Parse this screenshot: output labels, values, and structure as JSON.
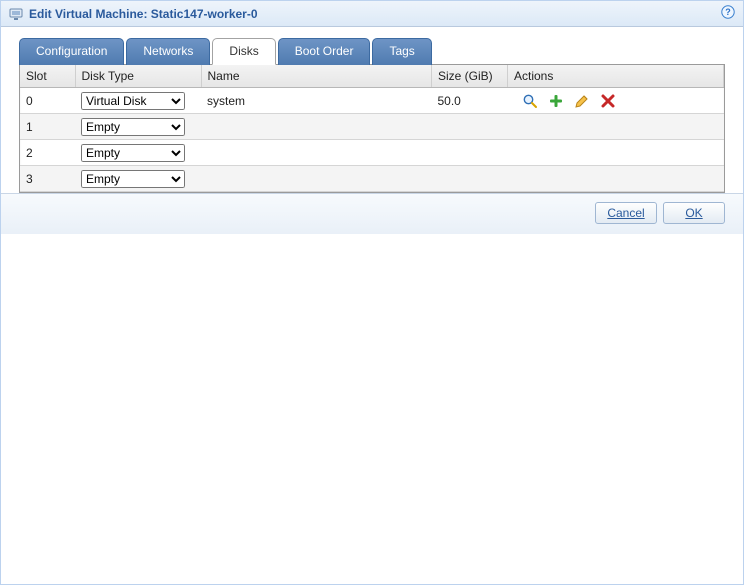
{
  "window": {
    "title": "Edit Virtual Machine: Static147-worker-0",
    "help_tooltip": "Help"
  },
  "tabs": [
    {
      "id": "configuration",
      "label": "Configuration",
      "active": false
    },
    {
      "id": "networks",
      "label": "Networks",
      "active": false
    },
    {
      "id": "disks",
      "label": "Disks",
      "active": true
    },
    {
      "id": "boot-order",
      "label": "Boot Order",
      "active": false
    },
    {
      "id": "tags",
      "label": "Tags",
      "active": false
    }
  ],
  "columns": {
    "slot": "Slot",
    "type": "Disk Type",
    "name": "Name",
    "size": "Size (GiB)",
    "actions": "Actions"
  },
  "disk_type_options": [
    "Virtual Disk",
    "Empty"
  ],
  "rows": [
    {
      "slot": "0",
      "type": "Virtual Disk",
      "name": "system",
      "size": "50.0",
      "show_actions": true
    },
    {
      "slot": "1",
      "type": "Empty",
      "name": "",
      "size": "",
      "show_actions": false
    },
    {
      "slot": "2",
      "type": "Empty",
      "name": "",
      "size": "",
      "show_actions": false
    },
    {
      "slot": "3",
      "type": "Empty",
      "name": "",
      "size": "",
      "show_actions": false
    }
  ],
  "action_icons": {
    "view": "view-icon",
    "add": "add-icon",
    "edit": "edit-icon",
    "delete": "delete-icon"
  },
  "footer": {
    "cancel": "Cancel",
    "ok": "OK"
  }
}
